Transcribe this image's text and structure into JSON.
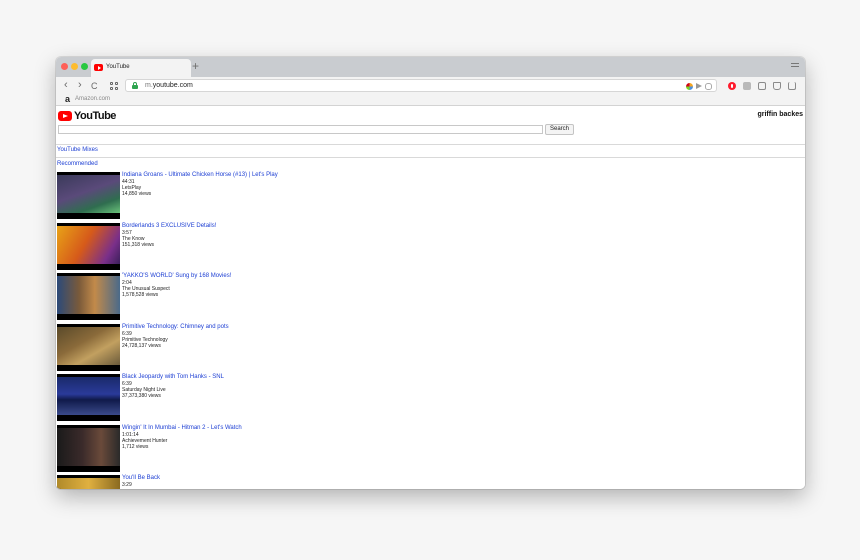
{
  "browser": {
    "tab": {
      "title": "YouTube"
    },
    "new_tab_label": "+",
    "nav": {
      "back": "‹",
      "forward": "›",
      "reload": "C"
    },
    "url": {
      "prefix": "m.",
      "domain": "youtube.com"
    },
    "bookmarks": [
      {
        "icon": "a",
        "label": "Amazon.com"
      }
    ]
  },
  "page": {
    "logo_text": "YouTube",
    "user_name": "griffin backes",
    "search": {
      "button_label": "Search",
      "placeholder": ""
    },
    "mixes_link": "YouTube Mixes",
    "section_title": "Recommended",
    "videos": [
      {
        "title": "Indiana Groans - Ultimate Chicken Horse (#13) | Let's Play",
        "duration": "44:31",
        "channel": "LetsPlay",
        "views": "14,850 views"
      },
      {
        "title": "Borderlands 3 EXCLUSIVE Details!",
        "duration": "3:57",
        "channel": "The Know",
        "views": "151,318 views"
      },
      {
        "title": "'YAKKO'S WORLD' Sung by 168 Movies!",
        "duration": "2:04",
        "channel": "The Unusual Suspect",
        "views": "1,578,528 views"
      },
      {
        "title": "Primitive Technology: Chimney and pots",
        "duration": "6:39",
        "channel": "Primitive Technology",
        "views": "24,728,137 views"
      },
      {
        "title": "Black Jeopardy with Tom Hanks - SNL",
        "duration": "6:39",
        "channel": "Saturday Night Live",
        "views": "37,373,380 views"
      },
      {
        "title": "Wingin' It In Mumbai - Hitman 2 - Let's Watch",
        "duration": "1:01:14",
        "channel": "Achievement Hunter",
        "views": "1,712 views"
      },
      {
        "title": "You'll Be Back",
        "duration": "3:29",
        "channel": "",
        "views": ""
      }
    ]
  },
  "colors": {
    "link": "#1c3ed3",
    "youtube_red": "#ff0000",
    "secure_green": "#2ea44f"
  }
}
